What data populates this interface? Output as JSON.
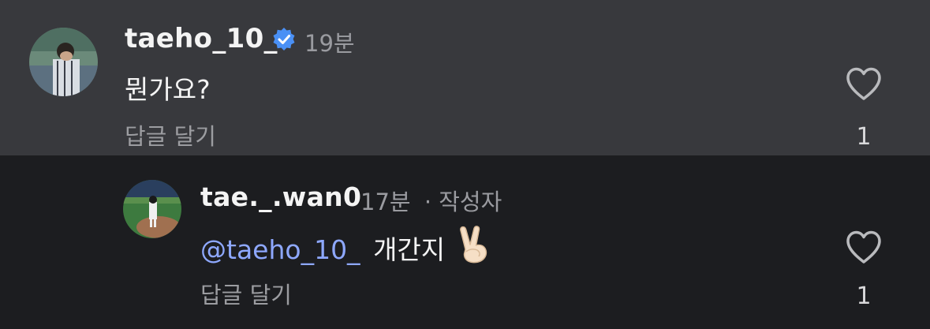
{
  "comments": [
    {
      "username": "taeho_10_",
      "time": "19분",
      "text": "뭔가요?",
      "reply_label": "답글 달기",
      "likes": "1",
      "verified": true
    },
    {
      "username": "tae._.wan0",
      "time": "17분",
      "author_tag": "· 작성자",
      "mention": "@taeho_10_",
      "text": "개간지",
      "emoji": "✌🏻",
      "reply_label": "답글 달기",
      "likes": "1"
    }
  ],
  "colors": {
    "top_bg": "#38393d",
    "bottom_bg": "#1c1d20",
    "mention": "#8ea8ff",
    "verified": "#4a90f5"
  }
}
